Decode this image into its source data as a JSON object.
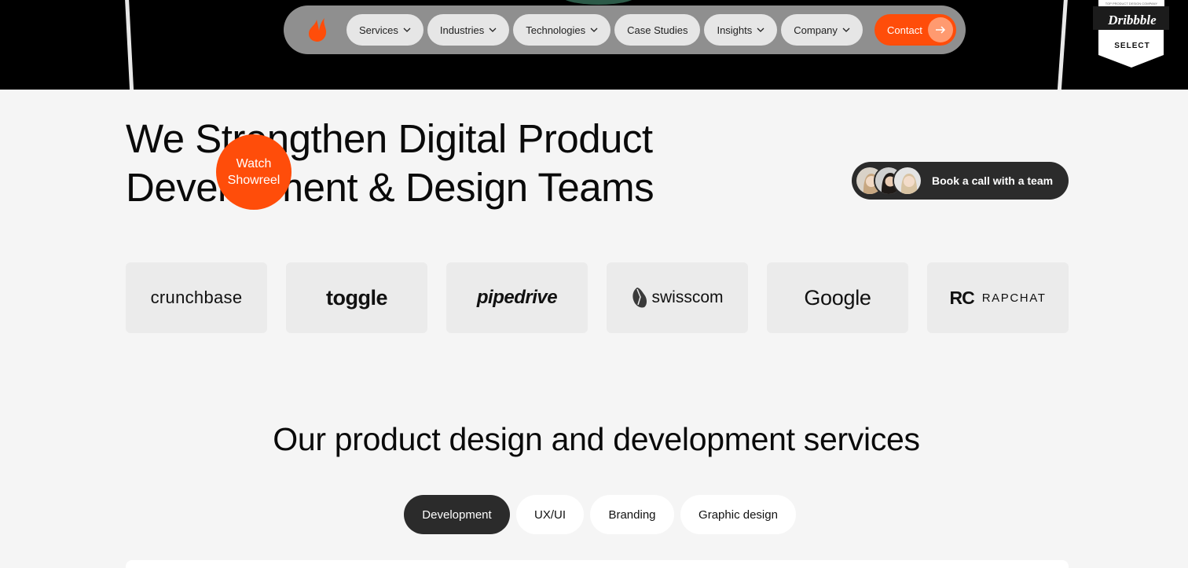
{
  "nav": {
    "items": [
      {
        "label": "Services",
        "dropdown": true
      },
      {
        "label": "Industries",
        "dropdown": true
      },
      {
        "label": "Technologies",
        "dropdown": true
      },
      {
        "label": "Case Studies",
        "dropdown": false
      },
      {
        "label": "Insights",
        "dropdown": true
      },
      {
        "label": "Company",
        "dropdown": true
      }
    ],
    "contact_label": "Contact"
  },
  "badge": {
    "brand": "Dribbble",
    "sub": "SELECT",
    "top_text": "TOP PRODUCT DESIGN COMPANY"
  },
  "hero": {
    "headline_line1": "We Strengthen Digital Product",
    "headline_line2": "Development & Design Teams",
    "showreel_line1": "Watch",
    "showreel_line2": "Showreel",
    "book_label": "Book a call with a team"
  },
  "clients": {
    "crunchbase": "crunchbase",
    "toggle": "toggle",
    "pipedrive": "pipedrive",
    "swisscom": "swisscom",
    "google": "Google",
    "rapchat_mark": "RC",
    "rapchat": "RAPCHAT"
  },
  "services": {
    "title": "Our product design and development services",
    "tabs": [
      {
        "label": "Development",
        "active": true
      },
      {
        "label": "UX/UI",
        "active": false
      },
      {
        "label": "Branding",
        "active": false
      },
      {
        "label": "Graphic design",
        "active": false
      }
    ]
  },
  "colors": {
    "accent": "#ff4d0a",
    "dark": "#2b2b2b",
    "background": "#f5f5f5"
  }
}
